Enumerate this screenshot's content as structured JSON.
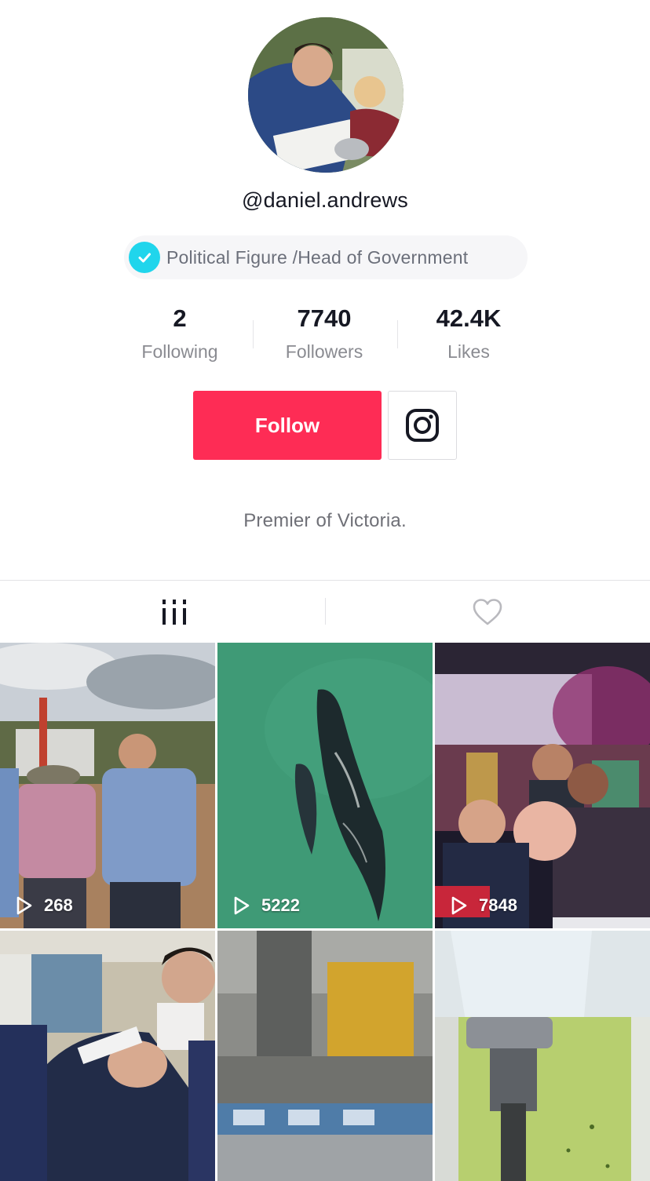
{
  "profile": {
    "username": "@daniel.andrews",
    "verified_label": "Political Figure /Head of Government",
    "bio": "Premier of Victoria."
  },
  "stats": [
    {
      "value": "2",
      "label": "Following"
    },
    {
      "value": "7740",
      "label": "Followers"
    },
    {
      "value": "42.4K",
      "label": "Likes"
    }
  ],
  "actions": {
    "follow_label": "Follow",
    "instagram_icon": "instagram-icon"
  },
  "tabs": [
    {
      "icon": "videos-grid-icon"
    },
    {
      "icon": "heart-icon"
    }
  ],
  "videos": [
    {
      "views": "268"
    },
    {
      "views": "5222"
    },
    {
      "views": "7848"
    },
    {
      "views": ""
    },
    {
      "views": ""
    },
    {
      "views": ""
    }
  ],
  "colors": {
    "accent": "#fe2c55",
    "verified": "#20d5ec"
  }
}
